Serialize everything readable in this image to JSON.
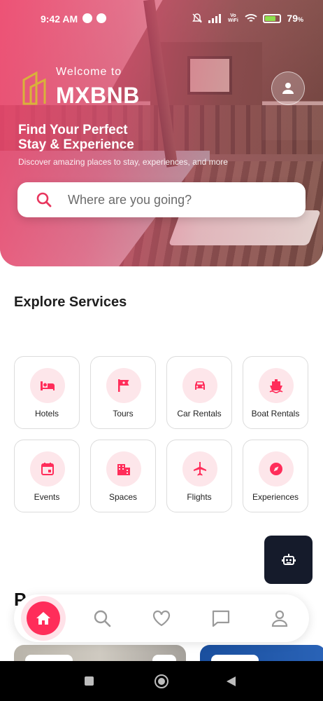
{
  "status_bar": {
    "time": "9:42 AM",
    "battery": "79",
    "battery_unit": "%",
    "network_label": "Vo WiFi"
  },
  "header": {
    "welcome": "Welcome to",
    "brand": "MXBNB",
    "tagline_line1": "Find Your Perfect",
    "tagline_line2": "Stay & Experience",
    "subtitle": "Discover amazing places to stay, experiences, and more"
  },
  "search": {
    "placeholder": "Where are you going?"
  },
  "explore": {
    "title": "Explore Services",
    "services": [
      {
        "label": "Hotels",
        "icon": "bed-icon"
      },
      {
        "label": "Tours",
        "icon": "flag-icon"
      },
      {
        "label": "Car Rentals",
        "icon": "car-icon"
      },
      {
        "label": "Boat Rentals",
        "icon": "boat-icon"
      },
      {
        "label": "Events",
        "icon": "calendar-icon"
      },
      {
        "label": "Spaces",
        "icon": "building-icon"
      },
      {
        "label": "Flights",
        "icon": "airplane-icon"
      },
      {
        "label": "Experiences",
        "icon": "compass-icon"
      }
    ]
  },
  "popular": {
    "title": "P"
  },
  "bottom_nav": [
    "home-icon",
    "search-icon",
    "heart-icon",
    "chat-icon",
    "profile-icon"
  ],
  "colors": {
    "accent": "#ff2d5a",
    "accent_soft": "#fde6ea",
    "fab": "#151b2b"
  }
}
